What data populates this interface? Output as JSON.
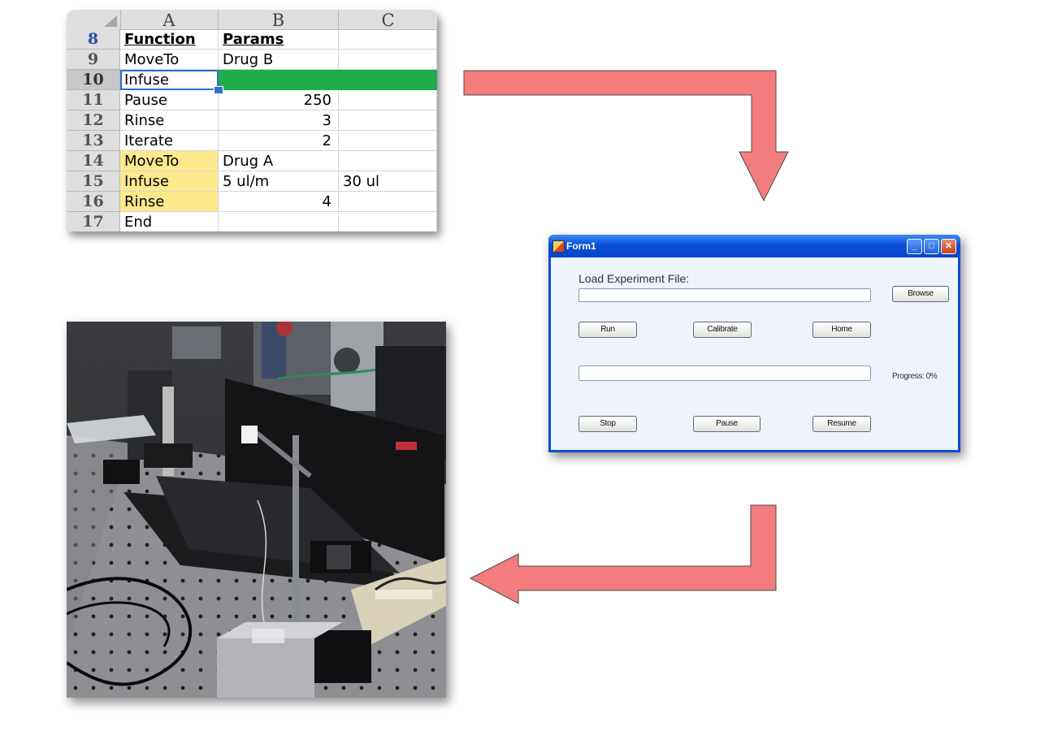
{
  "spreadsheet": {
    "columns": [
      "A",
      "B",
      "C"
    ],
    "rows": [
      {
        "num": "8",
        "cells": [
          "Function",
          "Params",
          ""
        ]
      },
      {
        "num": "9",
        "cells": [
          "MoveTo",
          "Drug B",
          ""
        ]
      },
      {
        "num": "10",
        "cells": [
          "Infuse",
          "",
          ""
        ]
      },
      {
        "num": "11",
        "cells": [
          "Pause",
          "250",
          ""
        ]
      },
      {
        "num": "12",
        "cells": [
          "Rinse",
          "3",
          ""
        ]
      },
      {
        "num": "13",
        "cells": [
          "Iterate",
          "2",
          ""
        ]
      },
      {
        "num": "14",
        "cells": [
          "MoveTo",
          "Drug A",
          ""
        ]
      },
      {
        "num": "15",
        "cells": [
          "Infuse",
          "5 ul/m",
          "30 ul"
        ]
      },
      {
        "num": "16",
        "cells": [
          "Rinse",
          "4",
          ""
        ]
      },
      {
        "num": "17",
        "cells": [
          "End",
          "",
          ""
        ]
      }
    ],
    "selected_cell": "A10",
    "colors": {
      "highlight_green": "#1fae4b",
      "highlight_yellow": "#fde98c"
    }
  },
  "form": {
    "title": "Form1",
    "load_label": "Load Experiment File:",
    "file_path_value": "",
    "browse_label": "Browse",
    "run_label": "Run",
    "calibrate_label": "Calibrate",
    "home_label": "Home",
    "progress_label": "Progress: 0%",
    "progress_value": 0,
    "stop_label": "Stop",
    "pause_label": "Pause",
    "resume_label": "Resume"
  },
  "arrows": {
    "color": "#f47c7c",
    "outline": "#4a4a4a"
  }
}
